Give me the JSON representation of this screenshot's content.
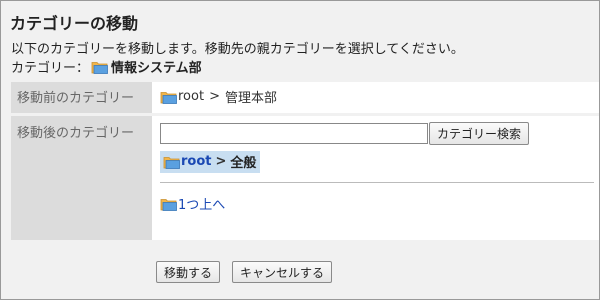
{
  "page": {
    "title": "カテゴリーの移動",
    "description": "以下のカテゴリーを移動します。移動先の親カテゴリーを選択してください。",
    "category_label": "カテゴリー：",
    "category_name": "情報システム部"
  },
  "form": {
    "before_label": "移動前のカテゴリー",
    "before_path": {
      "root": "root",
      "separator": ">",
      "current": "管理本部"
    },
    "after_label": "移動後のカテゴリー",
    "search": {
      "value": "",
      "button_label": "カテゴリー検索"
    },
    "selected_path": {
      "root": "root",
      "separator": ">",
      "current": "全般"
    },
    "up_link": "1つ上へ"
  },
  "actions": {
    "move_label": "移動する",
    "cancel_label": "キャンセルする"
  },
  "icons": {
    "folder": "folder-icon"
  },
  "colors": {
    "link": "#1a48b3",
    "selected_bg": "#c8def1",
    "label_bg": "#dcdcdc",
    "panel_bg": "#f1f1f1"
  }
}
